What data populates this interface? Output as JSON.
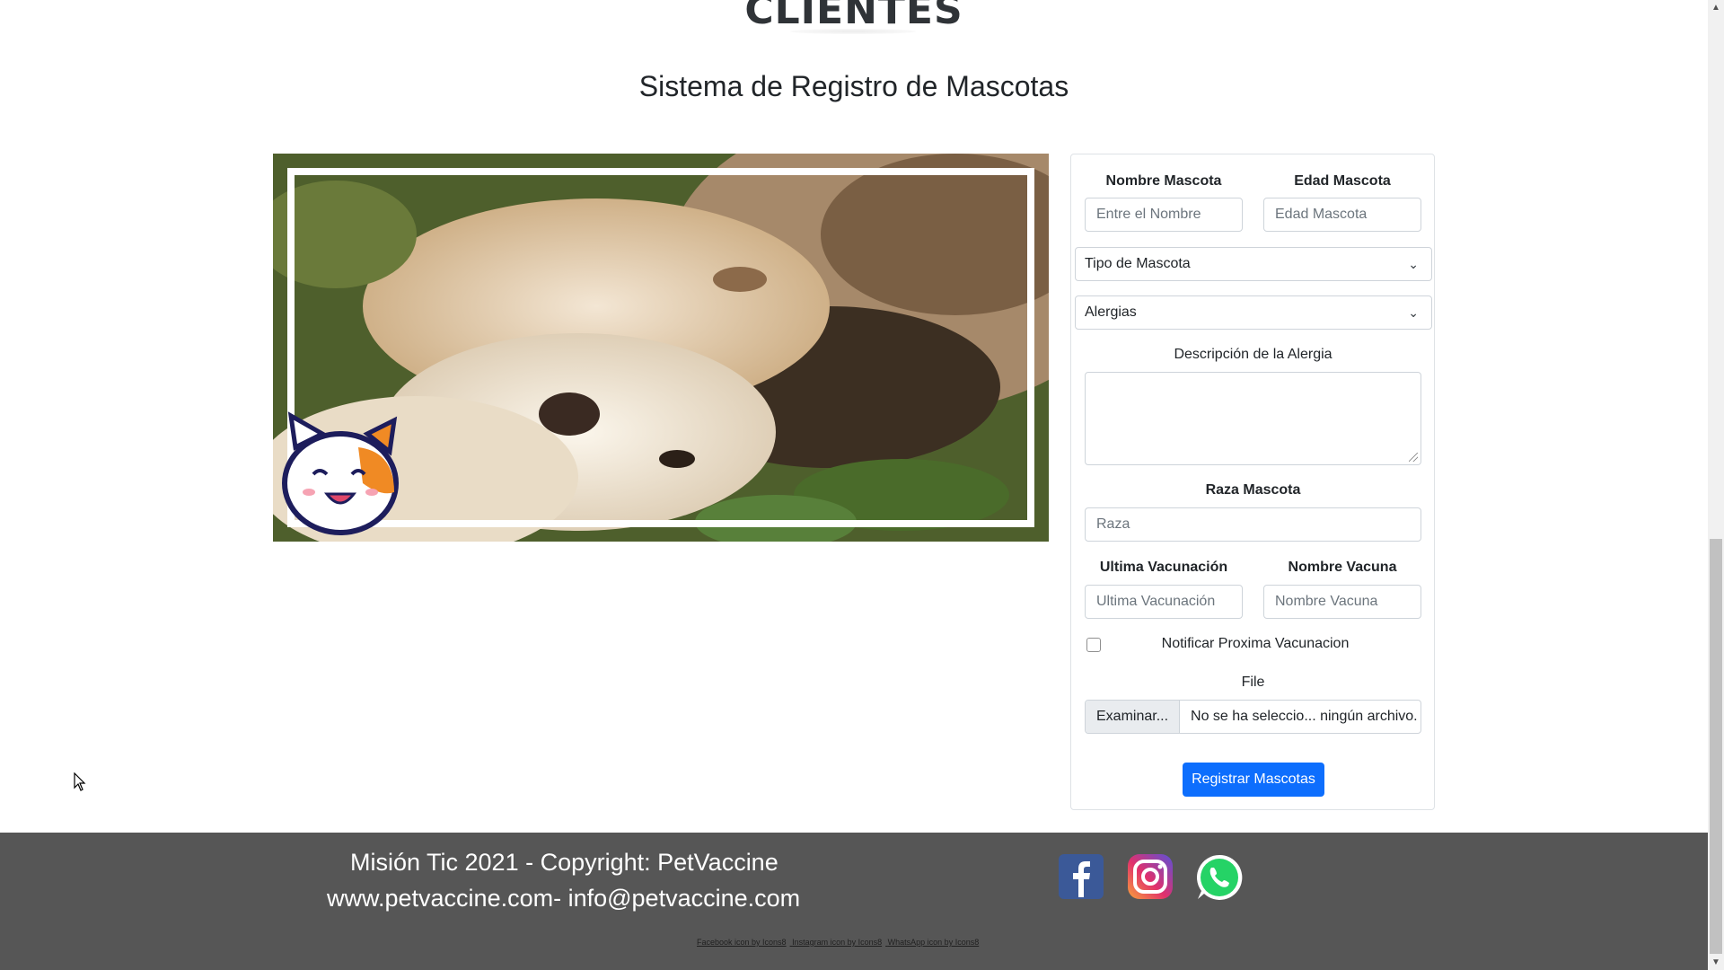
{
  "header": {
    "brand": "CLIENTES",
    "subtitle": "Sistema de Registro de Mascotas"
  },
  "form": {
    "nombre_label": "Nombre Mascota",
    "nombre_placeholder": "Entre el Nombre",
    "edad_label": "Edad Mascota",
    "edad_placeholder": "Edad Mascota",
    "tipo_select": "Tipo de Mascota",
    "alergias_select": "Alergias",
    "descripcion_label": "Descripción de la Alergia",
    "raza_label": "Raza Mascota",
    "raza_placeholder": "Raza",
    "ultima_label": "Ultima Vacunación",
    "ultima_placeholder": "Ultima Vacunación",
    "vacuna_label": "Nombre Vacuna",
    "vacuna_placeholder": "Nombre Vacuna",
    "notificar_label": "Notificar Proxima Vacunacion",
    "notificar_checked": false,
    "file_label": "File",
    "file_button": "Examinar...",
    "file_status": "No se ha seleccio... ningún archivo.",
    "submit": "Registrar Mascotas"
  },
  "footer": {
    "copyright": "Misión Tic 2021 - Copyright: PetVaccine",
    "site": "www.petvaccine.com- info@petvaccine.com",
    "credits": [
      "Facebook icon by Icons8",
      "Instagram icon by Icons8",
      "WhatsApp icon by Icons8"
    ],
    "colors": {
      "background": "#565656",
      "facebook": "#3b5998",
      "whatsapp": "#25d366"
    }
  },
  "icons": [
    "facebook-icon",
    "instagram-icon",
    "whatsapp-icon",
    "cat-mascot-icon",
    "chevron-down-icon"
  ],
  "colors": {
    "primary": "#0d6efd",
    "border": "#ced4da"
  }
}
